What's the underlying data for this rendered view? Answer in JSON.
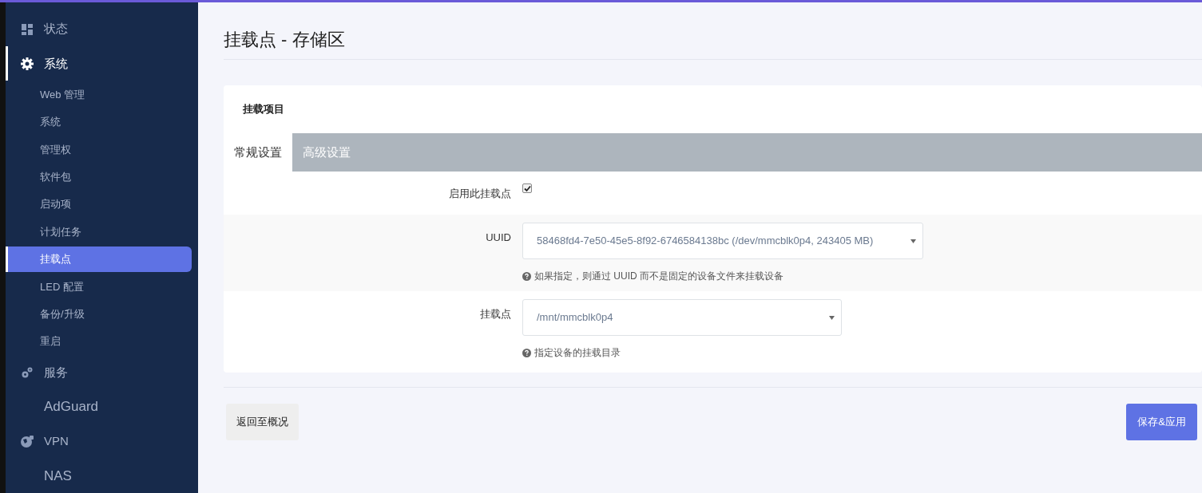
{
  "sidebar": {
    "items": [
      {
        "label": "状态",
        "active": false
      },
      {
        "label": "系统",
        "active": true,
        "children": [
          {
            "label": "Web 管理",
            "selected": false
          },
          {
            "label": "系统",
            "selected": false
          },
          {
            "label": "管理权",
            "selected": false
          },
          {
            "label": "软件包",
            "selected": false
          },
          {
            "label": "启动项",
            "selected": false
          },
          {
            "label": "计划任务",
            "selected": false
          },
          {
            "label": "挂载点",
            "selected": true
          },
          {
            "label": "LED 配置",
            "selected": false
          },
          {
            "label": "备份/升级",
            "selected": false
          },
          {
            "label": "重启",
            "selected": false
          }
        ]
      },
      {
        "label": "服务",
        "active": false
      },
      {
        "label": "AdGuard",
        "active": false
      },
      {
        "label": "VPN",
        "active": false
      },
      {
        "label": "NAS",
        "active": false
      }
    ]
  },
  "page": {
    "title": "挂载点 - 存储区"
  },
  "card": {
    "title": "挂载项目",
    "tabs": [
      {
        "label": "常规设置",
        "selected": true
      },
      {
        "label": "高级设置",
        "selected": false
      }
    ],
    "fields": [
      {
        "kind": "checkbox",
        "label": "启用此挂载点",
        "checked": true
      },
      {
        "kind": "select",
        "label": "UUID",
        "value": "58468fd4-7e50-45e5-8f92-6746584138bc (/dev/mmcblk0p4, 243405 MB)",
        "help": "如果指定，则通过 UUID 而不是固定的设备文件来挂载设备"
      },
      {
        "kind": "select",
        "label": "挂载点",
        "value": "/mnt/mmcblk0p4",
        "help": "指定设备的挂载目录"
      }
    ]
  },
  "actions": {
    "back": "返回至概况",
    "save": "保存&应用"
  }
}
